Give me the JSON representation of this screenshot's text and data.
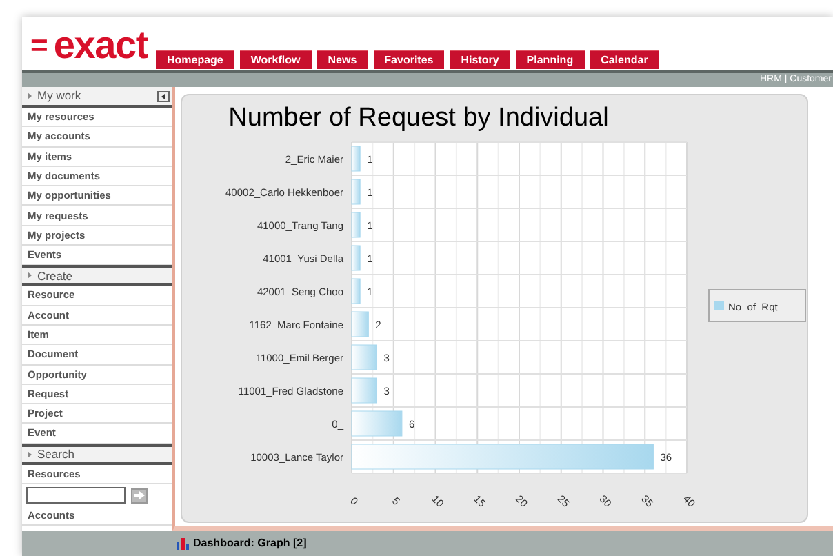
{
  "logo": {
    "mark": "=",
    "text": "exact"
  },
  "tabs": [
    {
      "label": "Homepage"
    },
    {
      "label": "Workflow"
    },
    {
      "label": "News"
    },
    {
      "label": "Favorites"
    },
    {
      "label": "History"
    },
    {
      "label": "Planning"
    },
    {
      "label": "Calendar"
    }
  ],
  "top_bar": {
    "text": "HRM | Customer"
  },
  "sidebar": {
    "sections": [
      {
        "title": "My work",
        "items": [
          {
            "kind": "link",
            "label": "My resources"
          },
          {
            "kind": "link",
            "label": "My accounts"
          },
          {
            "kind": "link",
            "label": "My items"
          },
          {
            "kind": "link",
            "label": "My documents"
          },
          {
            "kind": "link",
            "label": "My opportunities"
          },
          {
            "kind": "link",
            "label": "My requests"
          },
          {
            "kind": "link",
            "label": "My projects"
          },
          {
            "kind": "link",
            "label": "Events"
          }
        ]
      },
      {
        "title": "Create",
        "items": [
          {
            "kind": "link",
            "label": "Resource"
          },
          {
            "kind": "link",
            "label": "Account"
          },
          {
            "kind": "link",
            "label": "Item"
          },
          {
            "kind": "link",
            "label": "Document"
          },
          {
            "kind": "link",
            "label": "Opportunity"
          },
          {
            "kind": "link",
            "label": "Request"
          },
          {
            "kind": "link",
            "label": "Project"
          },
          {
            "kind": "link",
            "label": "Event"
          }
        ]
      },
      {
        "title": "Search",
        "items": [
          {
            "kind": "link",
            "label": "Resources"
          },
          {
            "kind": "search"
          },
          {
            "kind": "link",
            "label": "Accounts"
          }
        ]
      }
    ]
  },
  "chart": {
    "chart_data": {
      "type": "bar",
      "orientation": "horizontal",
      "title": "Number of Request by Individual",
      "categories": [
        "2_Eric Maier",
        "40002_Carlo Hekkenboer",
        "41000_Trang Tang",
        "41001_Yusi Della",
        "42001_Seng Choo",
        "1162_Marc Fontaine",
        "11000_Emil Berger",
        "11001_Fred Gladstone",
        "0_",
        "10003_Lance Taylor"
      ],
      "series": [
        {
          "name": "No_of_Rqt",
          "color": "#a8d8ee",
          "values": [
            1,
            1,
            1,
            1,
            1,
            2,
            3,
            3,
            6,
            36
          ]
        }
      ],
      "xlim": [
        0,
        40
      ],
      "grid": true,
      "xticks": [
        0,
        5,
        10,
        15,
        20,
        25,
        30,
        35,
        40
      ],
      "data_labels": true
    }
  },
  "bottom_bar": {
    "title": "Dashboard: Graph [2]"
  }
}
